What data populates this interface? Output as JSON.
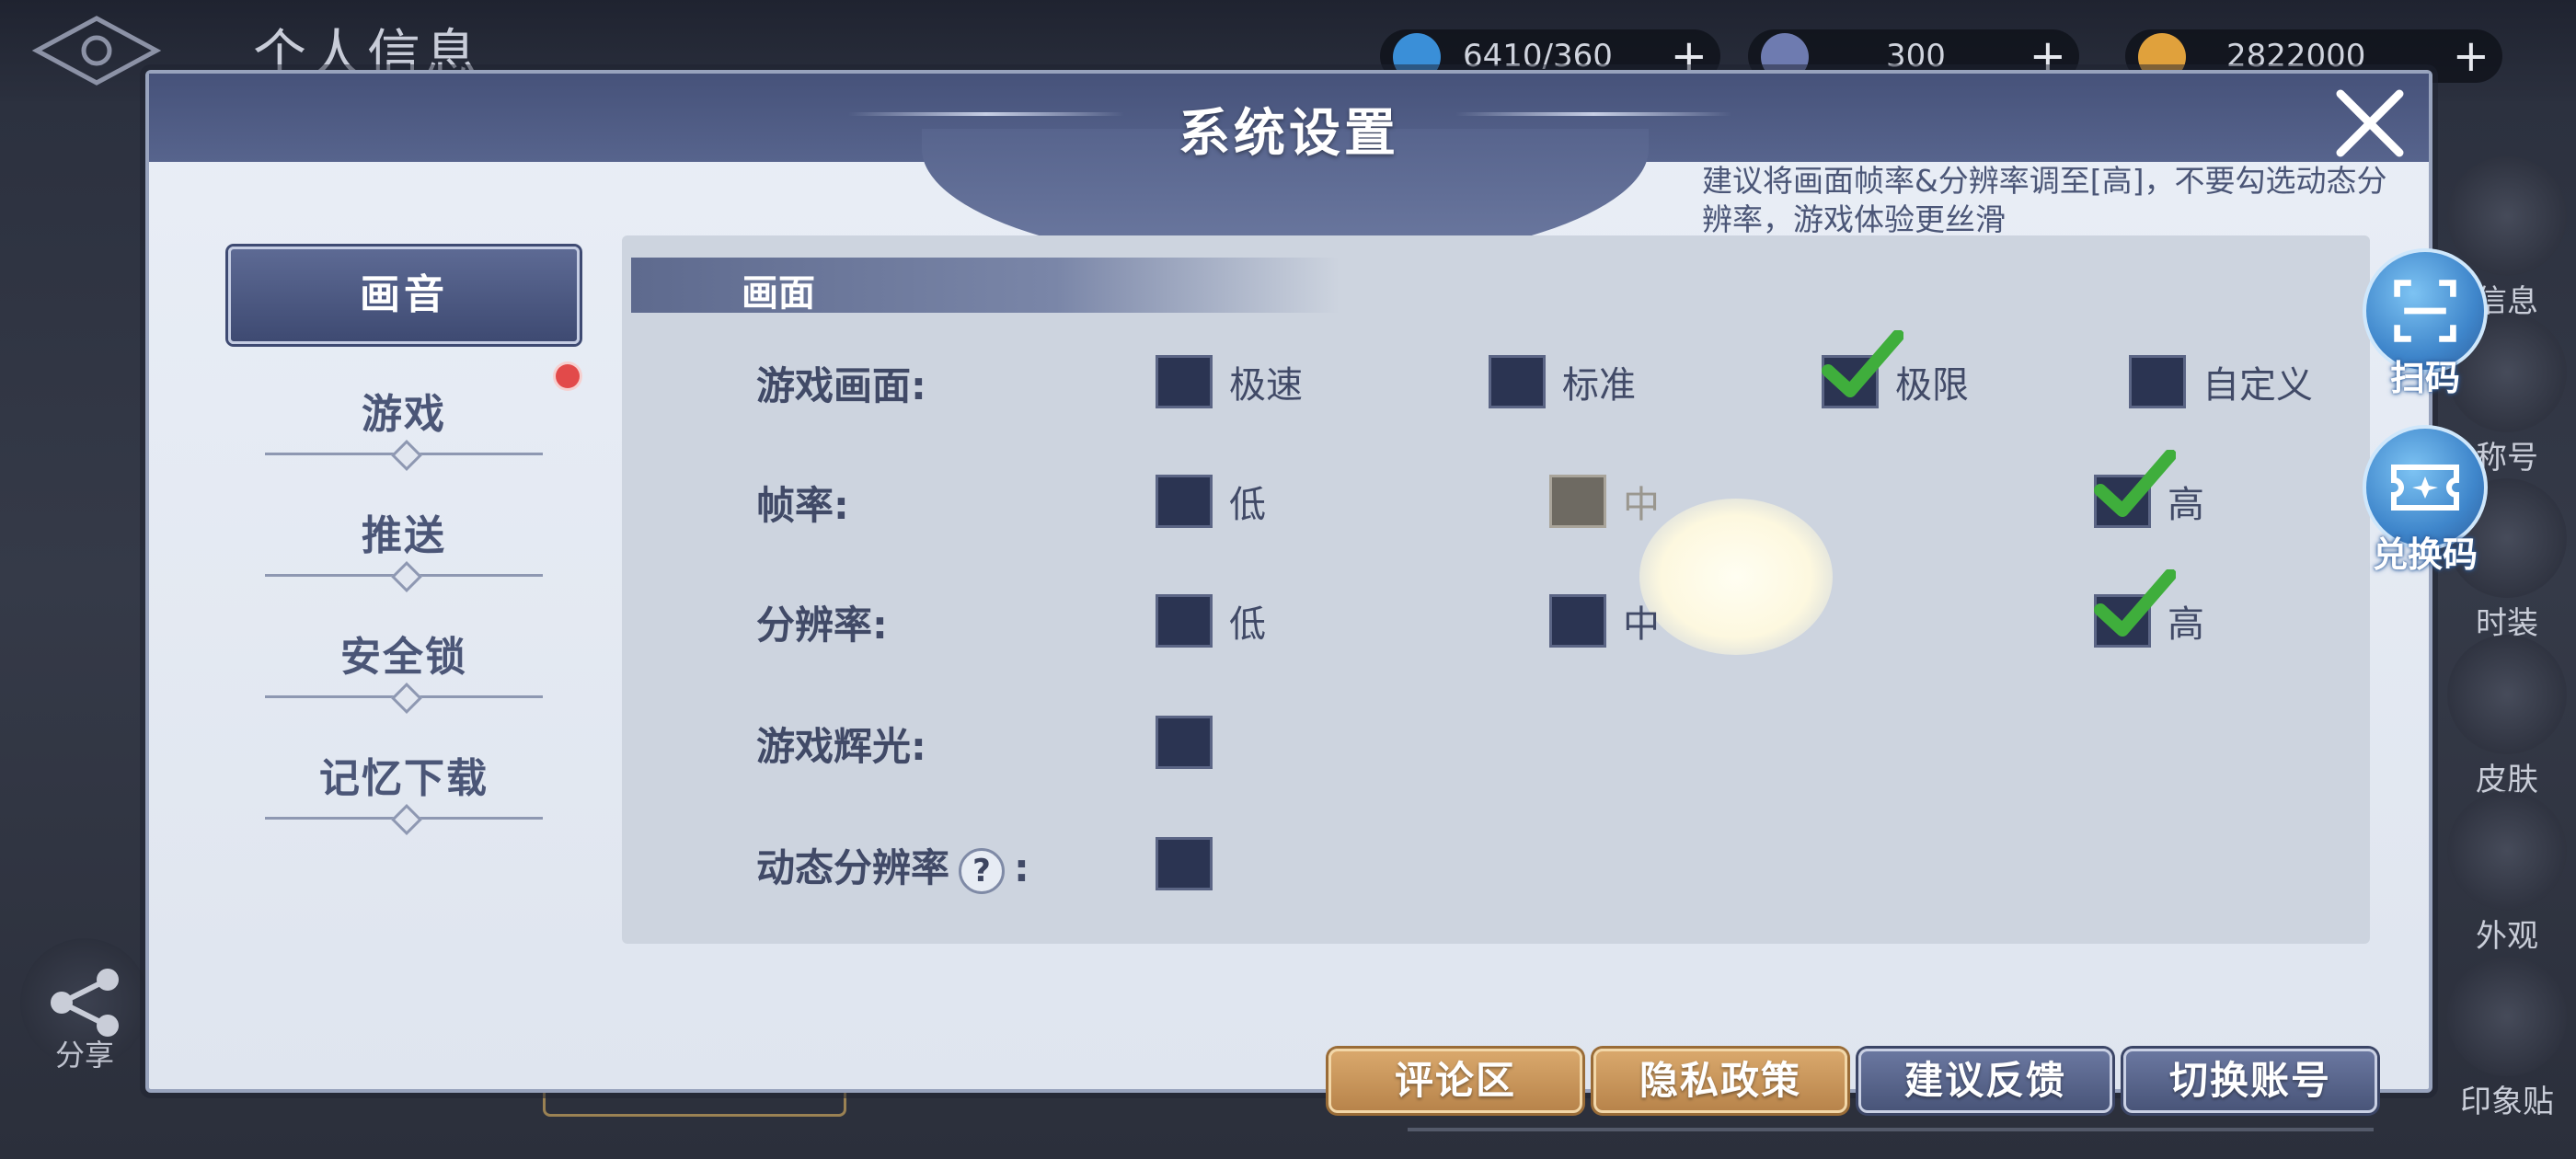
{
  "background": {
    "title": "个人信息",
    "resources": [
      {
        "name": "stamina",
        "value": "6410/360"
      },
      {
        "name": "gems",
        "value": "300"
      },
      {
        "name": "coins",
        "value": "2822000"
      }
    ],
    "side_labels": [
      "信息",
      "称号",
      "时装",
      "皮肤",
      "外观",
      "印象贴"
    ],
    "share_label": "分享"
  },
  "dialog": {
    "title": "系统设置",
    "hint": "建议将画面帧率&分辨率调至[高]，不要勾选动态分辨率，游戏体验更丝滑"
  },
  "nav": {
    "active": "画音",
    "items": [
      "游戏",
      "推送",
      "安全锁",
      "记忆下载"
    ],
    "has_badge": "游戏"
  },
  "section": {
    "title": "画面"
  },
  "settings": {
    "quality": {
      "label": "游戏画面:",
      "options": [
        "极速",
        "标准",
        "极限",
        "自定义"
      ],
      "selected": "极限"
    },
    "framerate": {
      "label": "帧率:",
      "options": [
        "低",
        "中",
        "高"
      ],
      "selected": "高"
    },
    "resolution": {
      "label": "分辨率:",
      "options": [
        "低",
        "中",
        "高"
      ],
      "selected": "高"
    },
    "glow": {
      "label": "游戏辉光:",
      "checked": false
    },
    "dynamic_res": {
      "label": "动态分辨率",
      "help": "?",
      "colon": ":",
      "checked": false
    }
  },
  "buttons": {
    "comments": "评论区",
    "privacy": "隐私政策",
    "feedback": "建议反馈",
    "switch_account": "切换账号"
  },
  "float_buttons": {
    "scan": "扫码",
    "redeem": "兑换码"
  },
  "colors": {
    "accent": "#4a5680",
    "checkbox": "#2b3452",
    "check_mark": "#3fae3c",
    "gold_button": "#c8965a"
  }
}
